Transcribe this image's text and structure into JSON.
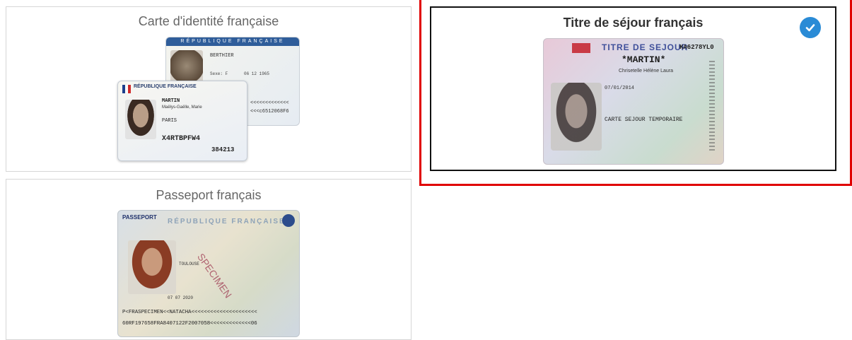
{
  "cards": [
    {
      "title": "Carte d'identité française",
      "selected": false,
      "images": {
        "old_header": "RÉPUBLIQUE FRANÇAISE",
        "new_header": "RÉPUBLIQUE FRANÇAISE",
        "new_name": "MARTIN",
        "new_given": "Maëlys-Gaëlle, Marie",
        "new_city": "PARIS",
        "new_number": "X4RTBPFW4",
        "new_code": "384213",
        "new_mrz": "<<<<<<<<<<<<<",
        "new_mrz2": "<<<c6512068F6",
        "old_name": "BERTHIER",
        "old_sex": "Sexe: F",
        "old_birth": "06 12 1965"
      }
    },
    {
      "title": "Titre de séjour français",
      "selected": true,
      "images": {
        "header": "TITRE DE SEJOUR",
        "number": "KA6278YL0",
        "name": "*MARTIN*",
        "given": "Chrisetelle Hélène Laura",
        "date": "07/01/2014",
        "type": "CARTE SEJOUR TEMPORAIRE"
      }
    },
    {
      "title": "Passeport français",
      "selected": false,
      "images": {
        "label": "PASSEPORT",
        "header": "RÉPUBLIQUE FRANÇAISE",
        "specimen": "SPECIMEN",
        "mrz1": "P<FRASPECIMEN<<NATACHA<<<<<<<<<<<<<<<<<<<<<",
        "mrz2": "60RF197658FRA8407122F2007058<<<<<<<<<<<<<06",
        "city": "TOULOUSE",
        "date": "07 07 2020"
      }
    }
  ],
  "selected_icon": "check-circle-icon",
  "colors": {
    "accent": "#2a8bd6",
    "highlight": "#e00000"
  }
}
